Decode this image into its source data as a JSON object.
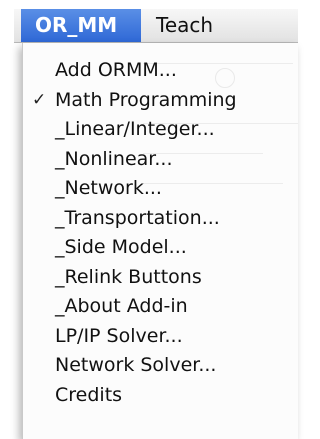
{
  "menubar": {
    "items": [
      {
        "label": "OR_MM",
        "active": true
      },
      {
        "label": "Teach",
        "active": false
      }
    ],
    "active_color": "#3a74dc"
  },
  "dropdown": {
    "items": [
      {
        "label": "Add ORMM...",
        "checked": false
      },
      {
        "label": "Math Programming",
        "checked": true
      },
      {
        "label": "_Linear/Integer...",
        "checked": false
      },
      {
        "label": "_Nonlinear...",
        "checked": false
      },
      {
        "label": "_Network...",
        "checked": false
      },
      {
        "label": "_Transportation...",
        "checked": false
      },
      {
        "label": "_Side Model...",
        "checked": false
      },
      {
        "label": "_Relink Buttons",
        "checked": false
      },
      {
        "label": "_About Add-in",
        "checked": false
      },
      {
        "label": "LP/IP Solver...",
        "checked": false
      },
      {
        "label": "Network Solver...",
        "checked": false
      },
      {
        "label": "Credits",
        "checked": false
      }
    ],
    "check_glyph": "✓"
  }
}
